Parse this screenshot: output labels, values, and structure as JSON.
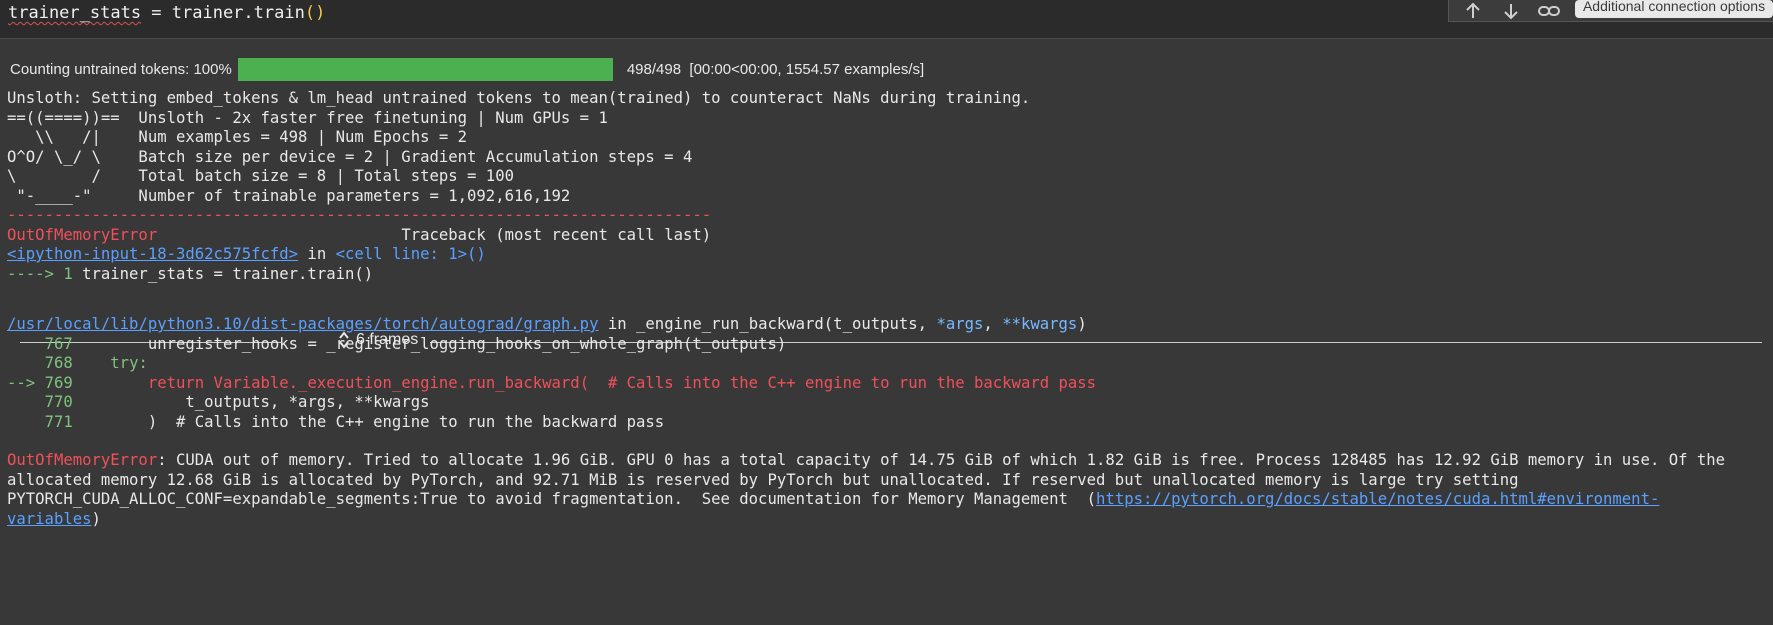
{
  "cell": {
    "code_var": "trainer_stats",
    "code_rest": " = trainer.train",
    "code_paren": "()"
  },
  "toolbar": {
    "up_icon": "arrow-up-icon",
    "down_icon": "arrow-down-icon",
    "link_icon": "link-icon",
    "tooltip": "Additional connection options"
  },
  "progress": {
    "label": "Counting untrained tokens: 100%",
    "fraction": 1.0,
    "bar_color": "#4caf50",
    "counts": "498/498",
    "timing": "[00:00<00:00,",
    "rate": "1554.57 examples/s]"
  },
  "log_lines": [
    "Unsloth: Setting embed_tokens & lm_head untrained tokens to mean(trained) to counteract NaNs during training.",
    "==((====))==  Unsloth - 2x faster free finetuning | Num GPUs = 1",
    "   \\\\   /|    Num examples = 498 | Num Epochs = 2",
    "O^O/ \\_/ \\    Batch size per device = 2 | Gradient Accumulation steps = 4",
    "\\        /    Total batch size = 8 | Total steps = 100",
    " \"-____-\"     Number of trainable parameters = 1,092,616,192"
  ],
  "traceback": {
    "dashes": "---------------------------------------------------------------------------",
    "error_name": "OutOfMemoryError",
    "header_right": "Traceback (most recent call last)",
    "input_link": "<ipython-input-18-3d62c575fcfd>",
    "in_word": " in ",
    "cell_ref": "<cell line: 1>()",
    "arrow_line_prefix": "----> 1",
    "arrow_line_code": " trainer_stats = trainer.train()",
    "frames_label": "6 frames",
    "file_link": "/usr/local/lib/python3.10/dist-packages/torch/autograd/graph.py",
    "file_in": " in ",
    "func_sig_name": "_engine_run_backward(t_outputs, ",
    "func_sig_star1": "*args",
    "func_sig_sep": ", ",
    "func_sig_star2": "**kwargs",
    "func_sig_end": ")",
    "code_lines": [
      {
        "no": "767",
        "prefix": "    ",
        "text": "        unregister_hooks = _register_logging_hooks_on_whole_graph(t_outputs)"
      },
      {
        "no": "768",
        "prefix": "    ",
        "text": "    try:"
      },
      {
        "no": "769",
        "prefix": "--> ",
        "text": "        return Variable._execution_engine.run_backward(  # Calls into the C++ engine to run the backward pass"
      },
      {
        "no": "770",
        "prefix": "    ",
        "text": "            t_outputs, *args, **kwargs"
      },
      {
        "no": "771",
        "prefix": "    ",
        "text": "        )  # Calls into the C++ engine to run the backward pass"
      }
    ],
    "final_error_name": "OutOfMemoryError",
    "final_msg_1": ": CUDA out of memory. Tried to allocate 1.96 GiB. GPU 0 has a total capacity of 14.75 GiB of which 1.82 GiB is free. Process 128485 has 12.92 GiB memory in use. Of the",
    "final_msg_2": "allocated memory 12.68 GiB is allocated by PyTorch, and 92.71 MiB is reserved by PyTorch but unallocated. If reserved but unallocated memory is large try setting",
    "final_msg_3": "PYTORCH_CUDA_ALLOC_CONF=expandable_segments:True to avoid fragmentation.  See documentation for Memory Management  (",
    "doc_link_a": "https://pytorch.org/docs/stable/notes/cuda.html#environment-",
    "doc_link_b": "variables",
    "final_close": ")"
  }
}
